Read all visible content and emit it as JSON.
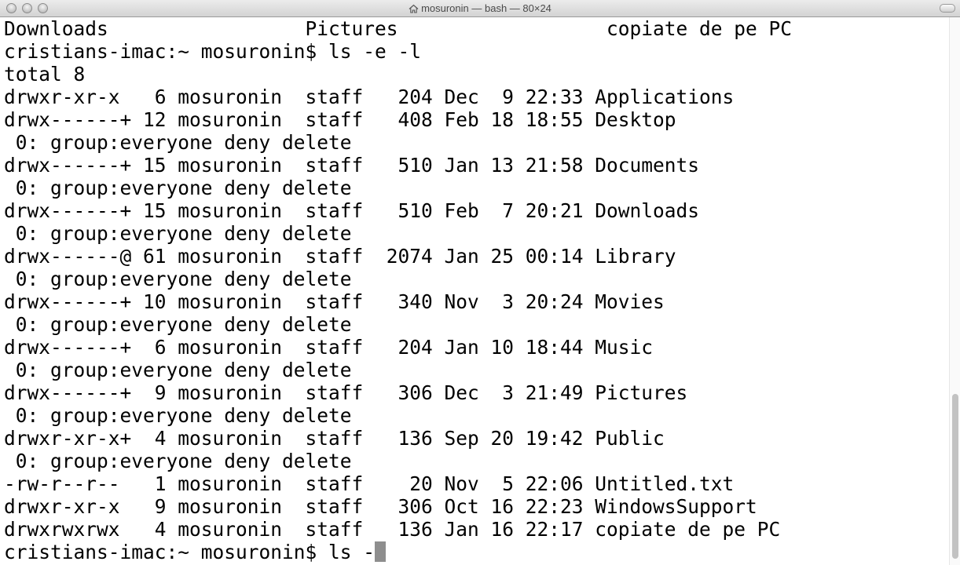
{
  "window": {
    "title": "mosuronin — bash — 80×24",
    "title_icon": "home-icon"
  },
  "terminal": {
    "lines": [
      "Downloads                 Pictures                  copiate de pe PC",
      "cristians-imac:~ mosuronin$ ls -e -l",
      "total 8",
      "drwxr-xr-x   6 mosuronin  staff   204 Dec  9 22:33 Applications",
      "drwx------+ 12 mosuronin  staff   408 Feb 18 18:55 Desktop",
      " 0: group:everyone deny delete",
      "drwx------+ 15 mosuronin  staff   510 Jan 13 21:58 Documents",
      " 0: group:everyone deny delete",
      "drwx------+ 15 mosuronin  staff   510 Feb  7 20:21 Downloads",
      " 0: group:everyone deny delete",
      "drwx------@ 61 mosuronin  staff  2074 Jan 25 00:14 Library",
      " 0: group:everyone deny delete",
      "drwx------+ 10 mosuronin  staff   340 Nov  3 20:24 Movies",
      " 0: group:everyone deny delete",
      "drwx------+  6 mosuronin  staff   204 Jan 10 18:44 Music",
      " 0: group:everyone deny delete",
      "drwx------+  9 mosuronin  staff   306 Dec  3 21:49 Pictures",
      " 0: group:everyone deny delete",
      "drwxr-xr-x+  4 mosuronin  staff   136 Sep 20 19:42 Public",
      " 0: group:everyone deny delete",
      "-rw-r--r--   1 mosuronin  staff    20 Nov  5 22:06 Untitled.txt",
      "drwxr-xr-x   9 mosuronin  staff   306 Oct 16 22:23 WindowsSupport",
      "drwxrwxrwx   4 mosuronin  staff   136 Jan 16 22:17 copiate de pe PC"
    ],
    "prompt_line": "cristians-imac:~ mosuronin$ ls -"
  }
}
